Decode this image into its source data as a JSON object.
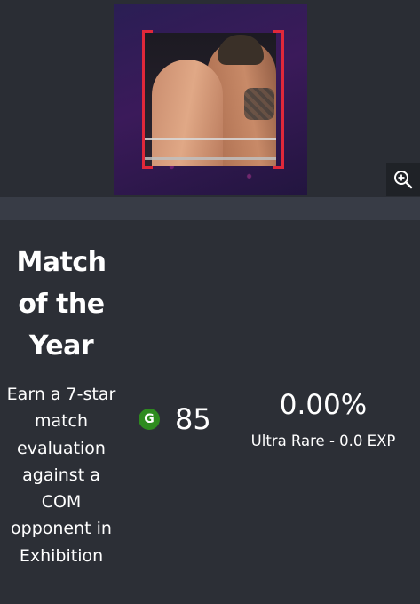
{
  "card": {
    "title": "Match of the Year",
    "description": "Earn a 7-star match evaluation against a COM opponent in Exhibition",
    "grade_letter": "G",
    "grade_value": "85",
    "percent": "0.00%",
    "rarity_line": "Ultra Rare - 0.0 EXP"
  },
  "icons": {
    "zoom": "zoom-in-icon",
    "grade": "grade-g-badge"
  },
  "colors": {
    "page_background": "#2c2f36",
    "band": "#383c46",
    "frame_accent": "#e0283a",
    "grade_badge": "#2e8b1f",
    "text": "#ffffff"
  }
}
